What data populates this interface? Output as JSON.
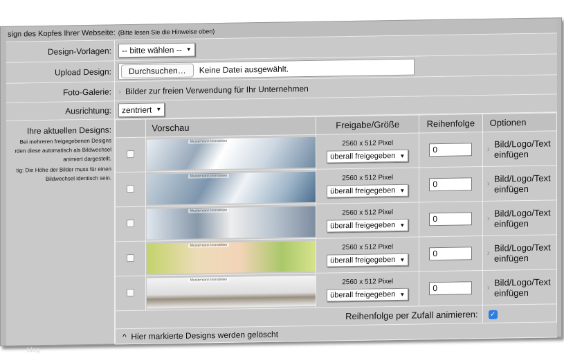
{
  "header": {
    "title": "sign des Kopfes Ihrer Webseite:",
    "hint": "(Bitte lesen Sie die Hinweise oben)"
  },
  "form": {
    "design_vorlagen": {
      "label": "Design-Vorlagen:",
      "value": "-- bitte wählen --"
    },
    "upload": {
      "label": "Upload Design:",
      "button": "Durchsuchen…",
      "status": "Keine Datei ausgewählt."
    },
    "galerie": {
      "label": "Foto-Galerie:",
      "link": "Bilder zur freien Verwendung für Ihr Unternehmen"
    },
    "ausrichtung": {
      "label": "Ausrichtung:",
      "value": "zentriert"
    }
  },
  "designs": {
    "title": "Ihre aktuellen Designs:",
    "note1": "Bei mehreren freigegebenen Designs rden diese automatisch als Bildwechsel animiert dargestellt.",
    "note2": "tig: Die Höhe der Bilder muss für einen Bildwechsel identisch sein.",
    "columns": [
      "Vorschau",
      "Freigabe/Größe",
      "Reihenfolge",
      "Optionen"
    ],
    "rows": [
      {
        "caption": "Mustermann Immobilien",
        "size": "2560 x 512 Pixel",
        "release": "überall freigegeben",
        "order": "0",
        "option": "Bild/Logo/Text einfügen"
      },
      {
        "caption": "Mustermann Immobilien",
        "size": "2560 x 512 Pixel",
        "release": "überall freigegeben",
        "order": "0",
        "option": "Bild/Logo/Text einfügen"
      },
      {
        "caption": "Mustermann Immobilien",
        "size": "2560 x 512 Pixel",
        "release": "überall freigegeben",
        "order": "0",
        "option": "Bild/Logo/Text einfügen"
      },
      {
        "caption": "Mustermann Immobilien",
        "size": "2560 x 512 Pixel",
        "release": "überall freigegeben",
        "order": "0",
        "option": "Bild/Logo/Text einfügen"
      },
      {
        "caption": "Mustermann Immobilien",
        "size": "2560 x 512 Pixel",
        "release": "überall freigegeben",
        "order": "0",
        "option": "Bild/Logo/Text einfügen"
      }
    ],
    "random_label": "Reihenfolge per Zufall animieren:",
    "delete_label": "Hier markierte Designs werden gelöscht"
  },
  "footer": {
    "watermark": "blog"
  }
}
